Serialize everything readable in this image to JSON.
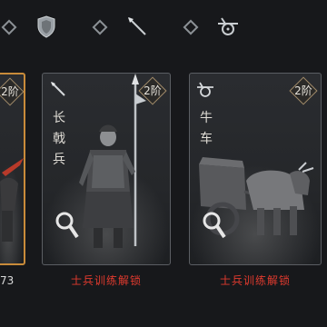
{
  "top_bar": {
    "icons": [
      "shield-icon",
      "spear-icon",
      "ox-cart-icon"
    ]
  },
  "cards": [
    {
      "id": "left-partial",
      "level": "2阶",
      "name": "",
      "selected": true,
      "footer": "73"
    },
    {
      "id": "halberd",
      "level": "2阶",
      "name_chars": [
        "长",
        "戟",
        "兵"
      ],
      "icon": "spear-icon",
      "selected": false,
      "footer": "士兵训练解锁"
    },
    {
      "id": "ox-cart",
      "level": "2阶",
      "name_chars": [
        "牛",
        "车"
      ],
      "icon": "ox-cart-icon",
      "selected": false,
      "footer": "士兵训练解锁"
    }
  ],
  "colors": {
    "accent_selected": "#c98b3a",
    "unlock_text": "#e03a2e"
  }
}
